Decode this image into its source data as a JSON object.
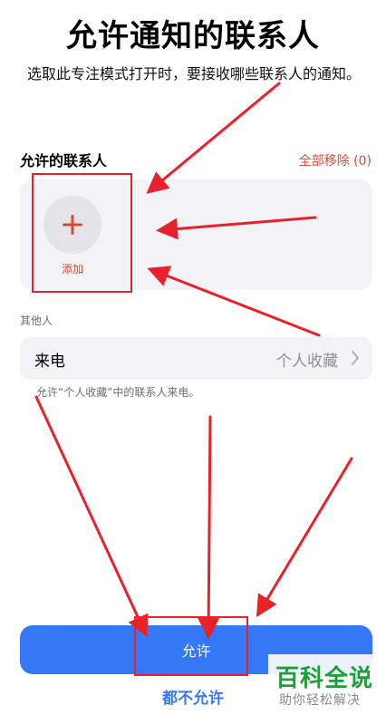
{
  "header": {
    "title": "允许通知的联系人",
    "subtitle": "选取此专注模式打开时，要接收哪些联系人的通知。"
  },
  "allowed_contacts": {
    "section_label": "允许的联系人",
    "remove_all_label": "全部移除 (0)",
    "add_label": "添加",
    "add_icon": "plus-icon"
  },
  "others": {
    "section_label": "其他人",
    "calls_label": "来电",
    "calls_value": "个人收藏",
    "calls_chevron": "chevron-right-icon",
    "footnote": "允许“个人收藏”中的联系人来电。"
  },
  "actions": {
    "allow_label": "允许",
    "deny_label": "都不允许"
  },
  "watermark": {
    "main": "百科全说",
    "sub": "助你轻松解决"
  },
  "colors": {
    "accent_blue": "#3478f6",
    "destructive_red": "#d94a3d",
    "annotation_red": "#e8202a",
    "watermark_green": "#1f9d3a"
  }
}
